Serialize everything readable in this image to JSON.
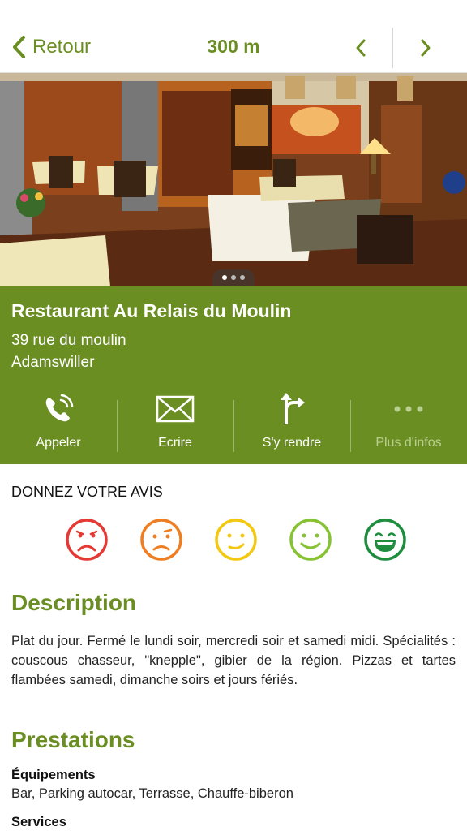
{
  "header": {
    "back_label": "Retour",
    "distance": "300 m"
  },
  "gallery": {
    "pages": 3,
    "active_page": 1
  },
  "place": {
    "name": "Restaurant Au Relais du Moulin",
    "street": "39  rue du moulin",
    "city": "Adamswiller"
  },
  "actions": [
    {
      "label": "Appeler",
      "icon": "phone-icon"
    },
    {
      "label": "Ecrire",
      "icon": "envelope-icon"
    },
    {
      "label": "S'y rendre",
      "icon": "directions-icon"
    },
    {
      "label": "Plus d'infos",
      "icon": "more-dots-icon"
    }
  ],
  "review": {
    "title": "DONNEZ VOTRE AVIS",
    "colors": [
      "#e53935",
      "#ef7d22",
      "#f2c811",
      "#86c232",
      "#1e8e3e"
    ]
  },
  "description": {
    "title": "Description",
    "text": "Plat du jour.  Fermé le lundi soir, mercredi soir et samedi midi. Spécialités : couscous chasseur, \"knepple\", gibier de la région. Pizzas et tartes flambées samedi, dimanche soirs et jours fériés."
  },
  "services": {
    "title": "Prestations",
    "equipment_label": "Équipements",
    "equipment_value": "Bar, Parking autocar, Terrasse, Chauffe-biberon",
    "services_label": "Services"
  },
  "colors": {
    "accent": "#6b8e23",
    "white": "#ffffff"
  }
}
